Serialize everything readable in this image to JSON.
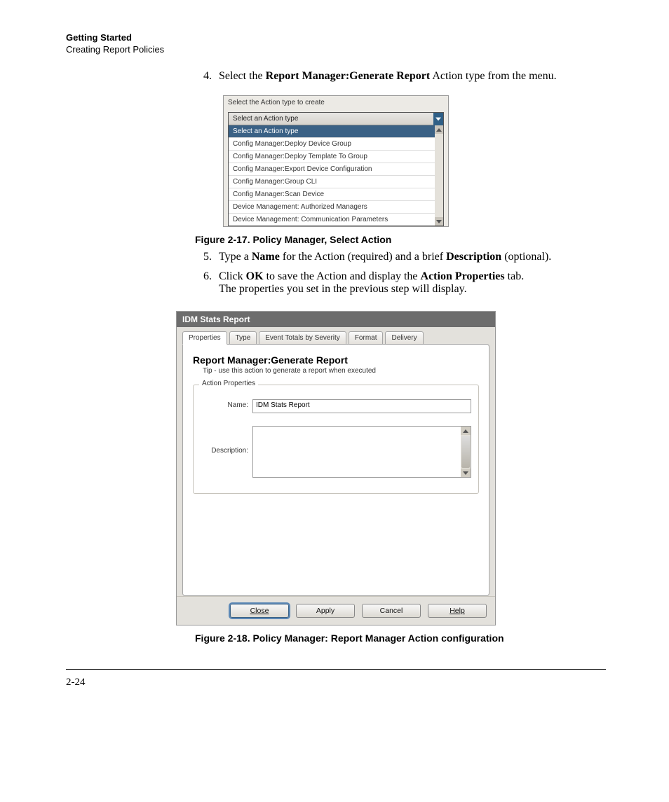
{
  "header": {
    "section": "Getting Started",
    "subsection": "Creating Report Policies"
  },
  "steps": {
    "s4_num": "4.",
    "s4_pre": "Select the ",
    "s4_bold": "Report Manager:Generate Report",
    "s4_post": " Action type from the menu.",
    "s5_num": "5.",
    "s5_a": "Type a ",
    "s5_b": "Name",
    "s5_c": " for the Action (required) and a brief ",
    "s5_d": "Description",
    "s5_e": " (optional).",
    "s6_num": "6.",
    "s6_a": "Click ",
    "s6_b": "OK",
    "s6_c": " to save the Action and display the ",
    "s6_d": "Action Properties",
    "s6_e": " tab.",
    "s6_line2": "The properties you set in the previous step will display."
  },
  "fig1": {
    "prompt": "Select the Action type to create",
    "select_head": "Select an Action type",
    "options": [
      "Select an Action type",
      "Config Manager:Deploy Device Group",
      "Config Manager:Deploy Template To Group",
      "Config Manager:Export Device Configuration",
      "Config Manager:Group CLI",
      "Config Manager:Scan Device",
      "Device Management: Authorized Managers",
      "Device Management: Communication Parameters"
    ],
    "caption": "Figure 2-17. Policy Manager, Select Action"
  },
  "fig2": {
    "panel_title": "IDM Stats Report",
    "tabs": [
      "Properties",
      "Type",
      "Event Totals by Severity",
      "Format",
      "Delivery"
    ],
    "main_title": "Report Manager:Generate Report",
    "tip": "Tip - use this action to generate a report when executed",
    "group_legend": "Action Properties",
    "name_label": "Name:",
    "name_value": "IDM Stats Report",
    "desc_label": "Description:",
    "buttons": {
      "close": "Close",
      "apply": "Apply",
      "cancel": "Cancel",
      "help": "Help"
    },
    "caption": "Figure 2-18. Policy Manager: Report Manager Action configuration"
  },
  "footer": {
    "pagenum": "2-24"
  }
}
